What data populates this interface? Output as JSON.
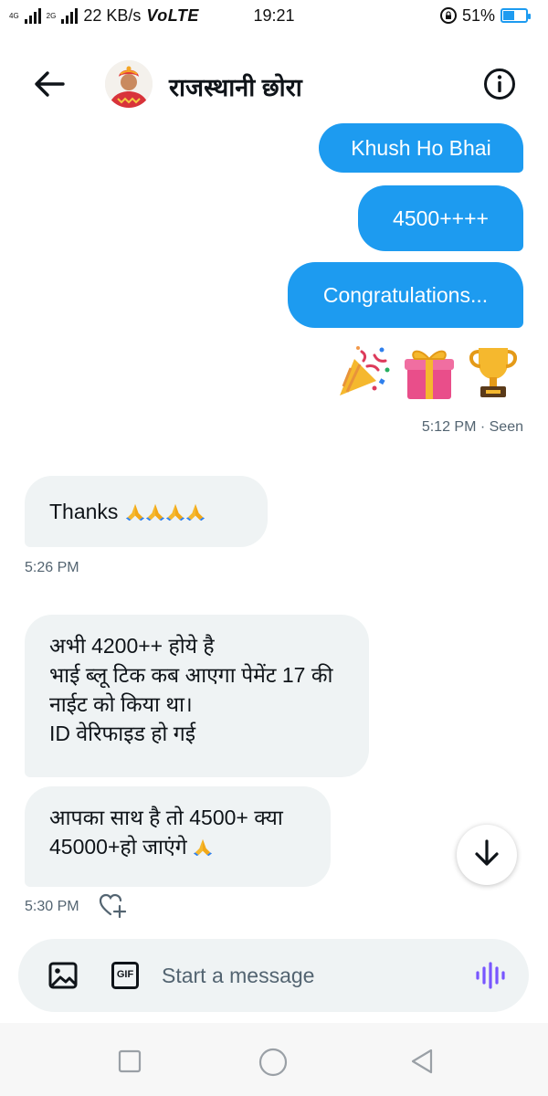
{
  "status_bar": {
    "network_badge_top": "4G",
    "network_badge_bottom": "2G",
    "speed": "22 KB/s",
    "volte": "VoLTE",
    "time": "19:21",
    "battery": "51%",
    "battery_level": 0.51,
    "accent_color": "#1d9bf0"
  },
  "header": {
    "title": "राजस्थानी छोरा",
    "back_icon": "arrow-left-icon",
    "info_icon": "info-icon"
  },
  "messages": {
    "sent": [
      {
        "text": "Khush Ho Bhai"
      },
      {
        "text": "4500++++"
      },
      {
        "text": "Congratulations..."
      }
    ],
    "sent_emoji": [
      "party-popper-icon",
      "gift-icon",
      "trophy-icon"
    ],
    "sent_meta": "5:12 PM · Seen",
    "received_1": {
      "text": "Thanks",
      "emoji_count": 4,
      "time": "5:26 PM"
    },
    "received_2": {
      "lines": [
        "अभी 4200++ होये है",
        "भाई ब्लू टिक कब आएगा पेमेंट 17 की",
        "नाईट को किया था।",
        "ID वेरिफाइड हो गई"
      ]
    },
    "received_3": {
      "line1": "आपका साथ है तो 4500+ क्या",
      "line2": "45000+हो जाएंगे",
      "time": "5:30 PM"
    }
  },
  "composer": {
    "placeholder": "Start a message",
    "gif_label": "GIF"
  },
  "colors": {
    "sent_bubble": "#1d9bf0",
    "received_bubble": "#eff3f4",
    "meta_text": "#536471",
    "voice_accent": "#7856ff"
  }
}
